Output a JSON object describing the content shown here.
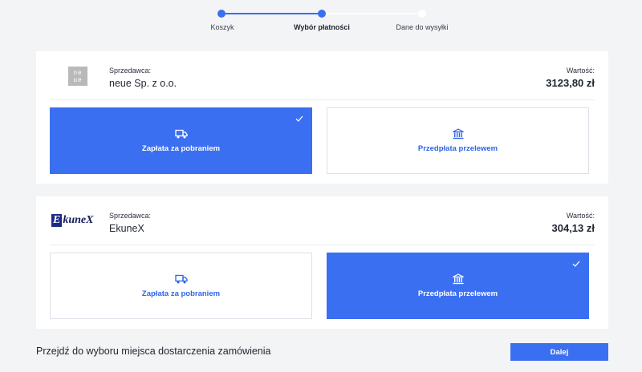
{
  "stepper": {
    "steps": [
      {
        "label": "Koszyk",
        "state": "done"
      },
      {
        "label": "Wybór płatności",
        "state": "current"
      },
      {
        "label": "Dane do wysyłki",
        "state": "pending"
      }
    ]
  },
  "sellers": [
    {
      "logo_text": "neue",
      "caption": "Sprzedawca:",
      "name": "neue Sp. z o.o.",
      "value_caption": "Wartość:",
      "value": "3123,80 zł",
      "options": [
        {
          "label": "Zapłata za pobraniem",
          "icon": "truck-icon",
          "selected": true
        },
        {
          "label": "Przedpłata przelewem",
          "icon": "bank-icon",
          "selected": false
        }
      ]
    },
    {
      "logo_text": "EkuneX",
      "caption": "Sprzedawca:",
      "name": "EkuneX",
      "value_caption": "Wartość:",
      "value": "304,13 zł",
      "options": [
        {
          "label": "Zapłata za pobraniem",
          "icon": "truck-icon",
          "selected": false
        },
        {
          "label": "Przedpłata przelewem",
          "icon": "bank-icon",
          "selected": true
        }
      ]
    }
  ],
  "footer": {
    "text": "Przejdź do wyboru miejsca dostarczenia zamówienia",
    "button_label": "Dalej"
  },
  "colors": {
    "accent": "#3b6ff2",
    "background": "#f3f4f6",
    "link": "#2e64e8"
  }
}
